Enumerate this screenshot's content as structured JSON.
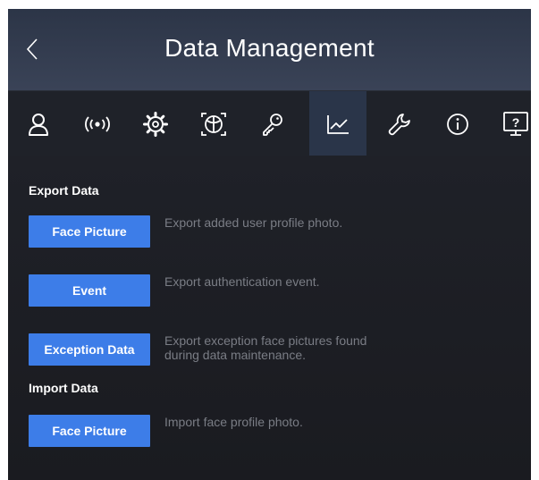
{
  "header": {
    "title": "Data Management",
    "back_icon": "chevron-left-icon"
  },
  "tabs": [
    {
      "icon": "user-icon"
    },
    {
      "icon": "wireless-signal-icon"
    },
    {
      "icon": "gear-icon"
    },
    {
      "icon": "face-scan-icon"
    },
    {
      "icon": "key-icon"
    },
    {
      "icon": "line-chart-icon",
      "active": true
    },
    {
      "icon": "wrench-icon"
    },
    {
      "icon": "info-icon"
    },
    {
      "icon": "help-monitor-icon",
      "glyph": "?"
    }
  ],
  "export": {
    "title": "Export Data",
    "items": [
      {
        "button": "Face Picture",
        "description": "Export added user profile photo."
      },
      {
        "button": "Event",
        "description": "Export authentication event."
      },
      {
        "button": "Exception Data",
        "description": "Export exception face pictures found\nduring data maintenance."
      }
    ]
  },
  "import": {
    "title": "Import Data",
    "items": [
      {
        "button": "Face Picture",
        "description": "Import face profile photo."
      }
    ]
  },
  "colors": {
    "accent": "#3d7de8",
    "header_bg": "#323c4f",
    "active_tab_bg": "#2a3549",
    "background": "#1b1d24",
    "description_text": "#7a7d85"
  }
}
